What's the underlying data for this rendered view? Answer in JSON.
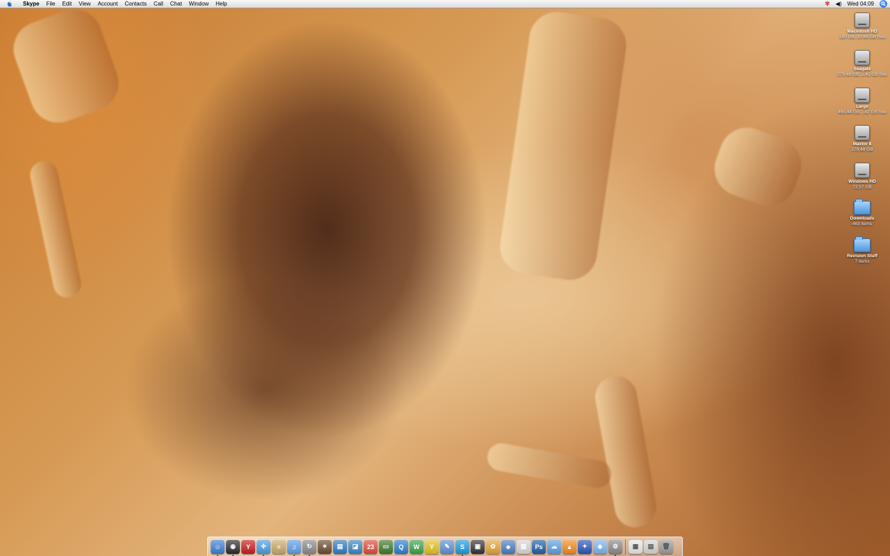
{
  "menubar": {
    "app_name": "Skype",
    "menus": [
      "File",
      "Edit",
      "View",
      "Account",
      "Contacts",
      "Call",
      "Chat",
      "Window",
      "Help"
    ],
    "clock": "Wed 04:09"
  },
  "desktop_icons": [
    {
      "label": "Macintosh HD",
      "sub": "160 GB, 30.86 GB free",
      "icon": "hard-drive-icon"
    },
    {
      "label": "Seagate",
      "sub": "279.46 GB, 2.41 GB free",
      "icon": "hard-drive-icon"
    },
    {
      "label": "Large",
      "sub": "465.44 GB,...82 GB free",
      "icon": "hard-drive-icon"
    },
    {
      "label": "Maxtor 8",
      "sub": "279.48 GB",
      "icon": "hard-drive-icon"
    },
    {
      "label": "Windows HD",
      "sub": "72.57 GB",
      "icon": "hard-drive-icon"
    },
    {
      "label": "Downloads",
      "sub": "463 items",
      "icon": "folder-icon"
    },
    {
      "label": "Revision Stuff",
      "sub": "7 items",
      "icon": "folder-icon"
    }
  ],
  "dock": {
    "items": [
      {
        "name": "finder-icon",
        "glyph": "☺",
        "color": "#3f7fd6",
        "running": true
      },
      {
        "name": "dashboard-icon",
        "glyph": "◉",
        "color": "#2b2b2b",
        "running": true
      },
      {
        "name": "app-red-icon",
        "glyph": "Y",
        "color": "#c81e1e",
        "running": false
      },
      {
        "name": "safari-icon",
        "glyph": "✣",
        "color": "#4a9be0",
        "running": true
      },
      {
        "name": "notes-icon",
        "glyph": "≡",
        "color": "#c9a968",
        "running": false
      },
      {
        "name": "itunes-icon",
        "glyph": "♫",
        "color": "#5d9ee8",
        "running": true
      },
      {
        "name": "sync-icon",
        "glyph": "↻",
        "color": "#8a8a8a",
        "running": true
      },
      {
        "name": "imovie-icon",
        "glyph": "✶",
        "color": "#6b4a2e",
        "running": false
      },
      {
        "name": "film-icon",
        "glyph": "▤",
        "color": "#2e7bc4",
        "running": false
      },
      {
        "name": "photo-icon",
        "glyph": "◪",
        "color": "#3a86c6",
        "running": false
      },
      {
        "name": "ical-icon",
        "glyph": "23",
        "color": "#e04b3d",
        "running": false
      },
      {
        "name": "drive-icon",
        "glyph": "▭",
        "color": "#3f7a2e",
        "running": false
      },
      {
        "name": "q-icon",
        "glyph": "Q",
        "color": "#2c7fd1",
        "running": false
      },
      {
        "name": "w-icon",
        "glyph": "W",
        "color": "#3aa34a",
        "running": false
      },
      {
        "name": "yahoo-messenger-icon",
        "glyph": "Y",
        "color": "#e2c21f",
        "running": false
      },
      {
        "name": "text-doc-icon",
        "glyph": "✎",
        "color": "#5d8fd6",
        "running": false
      },
      {
        "name": "skype-icon",
        "glyph": "S",
        "color": "#1e9be0",
        "running": true
      },
      {
        "name": "terminal-icon",
        "glyph": "▣",
        "color": "#333333",
        "running": false
      },
      {
        "name": "adium-icon",
        "glyph": "✿",
        "color": "#e6a33a",
        "running": false
      },
      {
        "name": "people-icon",
        "glyph": "☻",
        "color": "#4d7fc0",
        "running": false
      },
      {
        "name": "document-icon",
        "glyph": "▥",
        "color": "#d8d8d8",
        "running": false
      },
      {
        "name": "photoshop-icon",
        "glyph": "Ps",
        "color": "#1f5fa8",
        "running": false
      },
      {
        "name": "ichat-icon",
        "glyph": "☁",
        "color": "#5ba0e4",
        "running": false
      },
      {
        "name": "vlc-icon",
        "glyph": "▲",
        "color": "#f08a1f",
        "running": false
      },
      {
        "name": "bird-icon",
        "glyph": "✦",
        "color": "#2a55b8",
        "running": false
      },
      {
        "name": "preview-icon",
        "glyph": "◈",
        "color": "#7db3e8",
        "running": false
      },
      {
        "name": "system-preferences-icon",
        "glyph": "⚙",
        "color": "#8a8a8a",
        "running": true
      }
    ],
    "trailing": [
      {
        "name": "stack-icon",
        "glyph": "▦",
        "color": "#e8e8e8"
      },
      {
        "name": "downloads-stack-icon",
        "glyph": "▤",
        "color": "#d6d6d6"
      },
      {
        "name": "trash-icon",
        "glyph": "🗑",
        "color": "#9a9a9a"
      }
    ]
  }
}
